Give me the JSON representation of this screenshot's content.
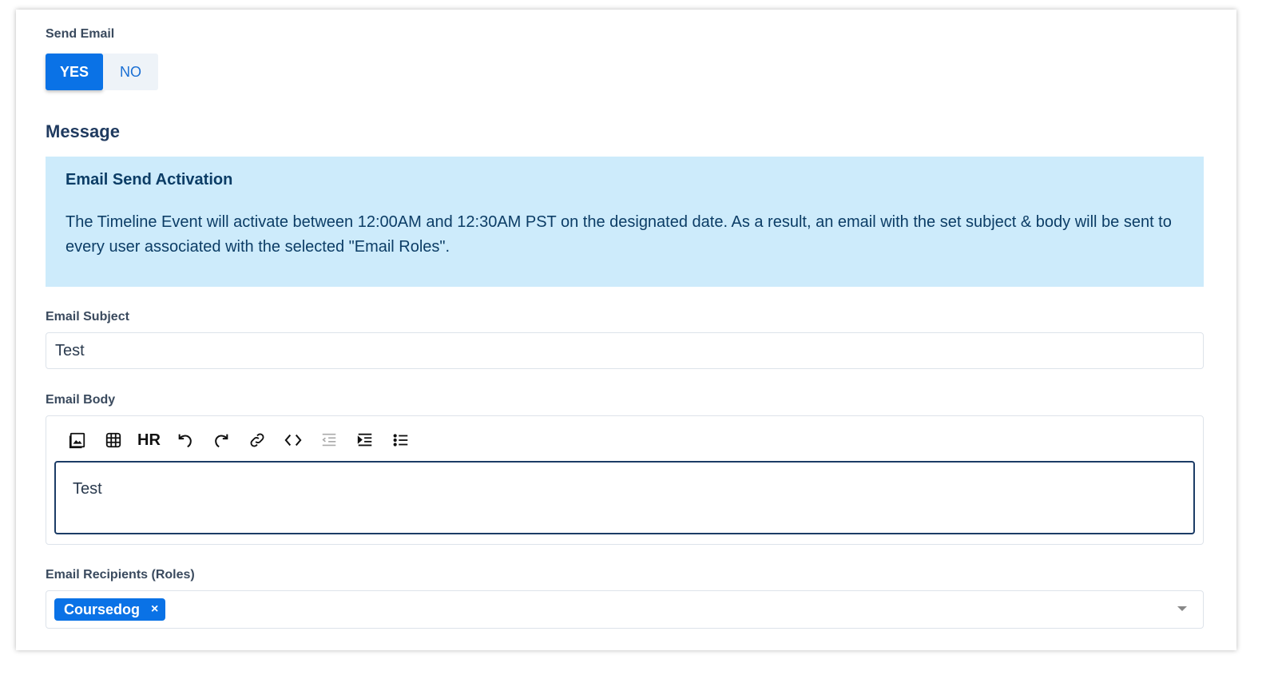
{
  "send_email": {
    "label": "Send Email",
    "options": [
      "YES",
      "NO"
    ],
    "selected": "YES"
  },
  "message": {
    "title": "Message",
    "alert": {
      "title": "Email Send Activation",
      "text": "The Timeline Event will activate between 12:00AM and 12:30AM PST on the designated date. As a result, an email with the set subject & body will be sent to every user associated with the selected \"Email Roles\"."
    }
  },
  "email_subject": {
    "label": "Email Subject",
    "value": "Test"
  },
  "email_body": {
    "label": "Email Body",
    "toolbar": {
      "hr_label": "HR",
      "icons": [
        "image-icon",
        "table-icon",
        "horizontal-rule",
        "undo-icon",
        "redo-icon",
        "link-icon",
        "code-icon",
        "outdent-icon",
        "indent-icon",
        "bullet-list-icon"
      ]
    },
    "value": "Test"
  },
  "email_recipients": {
    "label": "Email Recipients (Roles)",
    "chips": [
      {
        "label": "Coursedog",
        "remove": "×"
      }
    ]
  },
  "colors": {
    "primary": "#0a72e6",
    "alert_bg": "#cdebfb",
    "alert_text": "#0c3d66",
    "heading": "#1f3a5f"
  }
}
